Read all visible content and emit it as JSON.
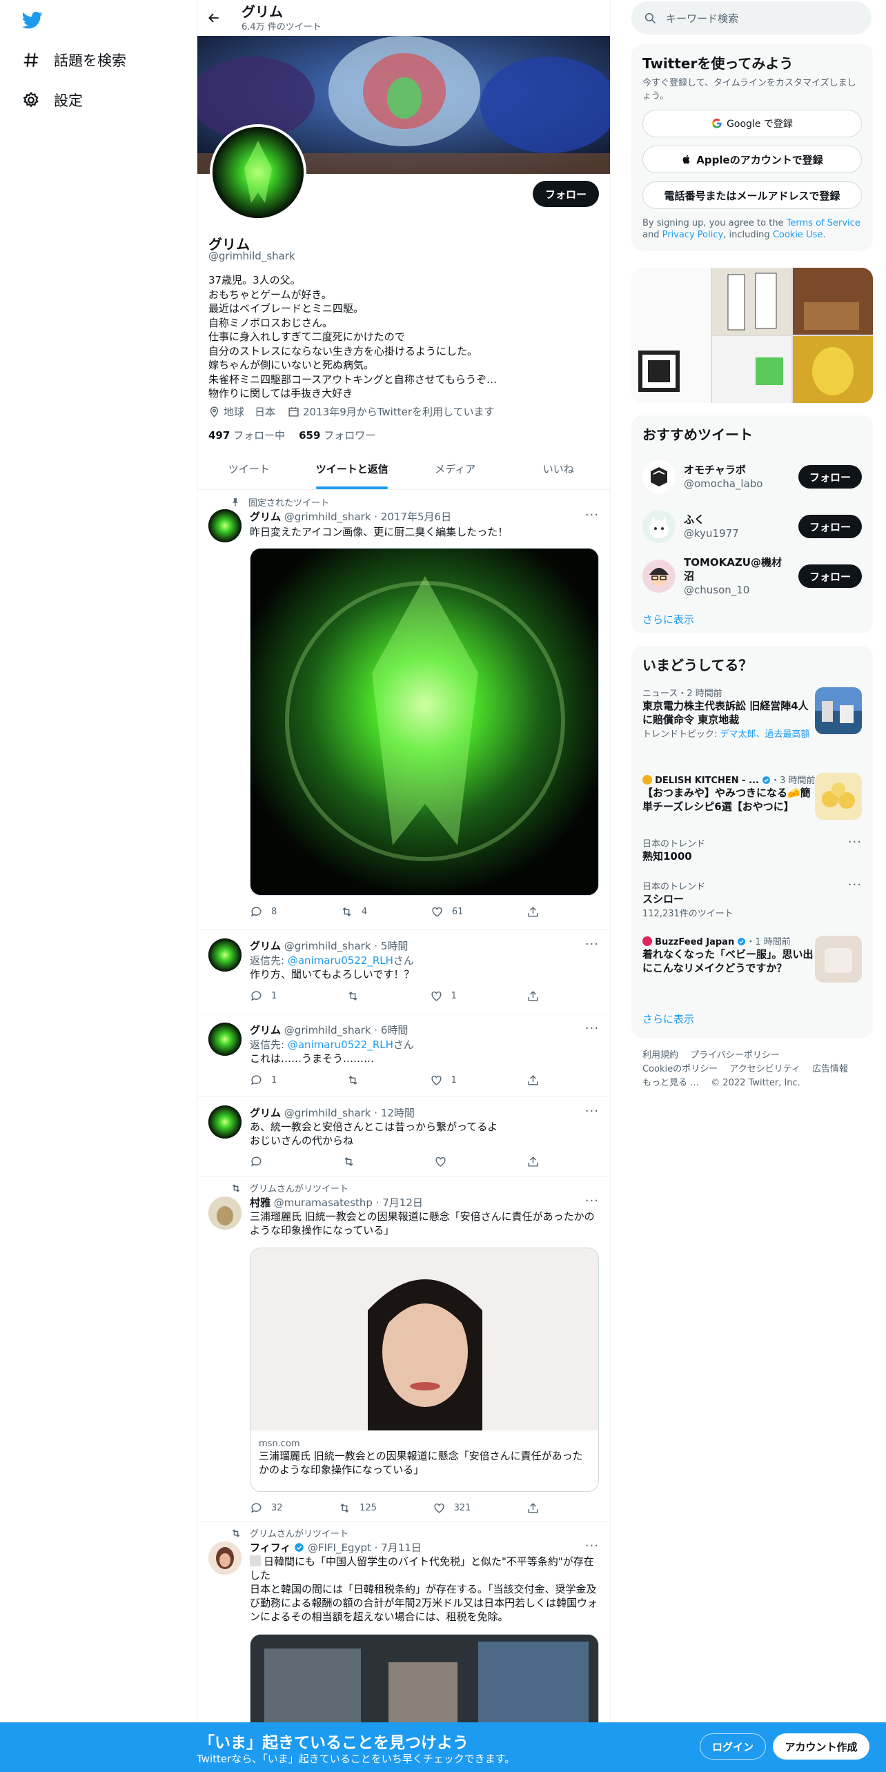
{
  "nav": {
    "explore": "話題を検索",
    "settings": "設定"
  },
  "header": {
    "title": "グリム",
    "subtitle": "6.4万 件のツイート"
  },
  "profile": {
    "name": "グリム",
    "handle": "@grimhild_shark",
    "follow_button": "フォロー",
    "bio": "37歳児。3人の父。\nおもちゃとゲームが好き。\n最近はベイブレードとミニ四駆。\n自称ミノボロスおじさん。\n仕事に身入れしすぎて二度死にかけたので\n自分のストレスにならない生き方を心掛けるようにした。\n嫁ちゃんが側にいないと死ぬ病気。\n朱雀杯ミニ四駆部コースアウトキングと自称させてもらうぞ…\n物作りに関しては手抜き大好き",
    "location": "地球　日本",
    "joined": "2013年9月からTwitterを利用しています",
    "following_count": "497",
    "following_label": "フォロー中",
    "followers_count": "659",
    "followers_label": "フォロワー"
  },
  "tabs": [
    "ツイート",
    "ツイートと返信",
    "メディア",
    "いいね"
  ],
  "tweets": [
    {
      "context": "固定されたツイート",
      "name": "グリム",
      "handle": "@grimhild_shark",
      "time": "2017年5月6日",
      "text": "昨日変えたアイコン画像、更に厨二臭く編集したった！",
      "replies": "8",
      "retweets": "4",
      "likes": "61"
    },
    {
      "name": "グリム",
      "handle": "@grimhild_shark",
      "time": "5時間",
      "reply_prefix": "返信先: ",
      "reply_to": "@animaru0522_RLH",
      "reply_suffix": "さん",
      "text": "作り方、聞いてもよろしいです！？",
      "replies": "1",
      "retweets": "",
      "likes": "1"
    },
    {
      "name": "グリム",
      "handle": "@grimhild_shark",
      "time": "6時間",
      "reply_prefix": "返信先: ",
      "reply_to": "@animaru0522_RLH",
      "reply_suffix": "さん",
      "text": "これは……うまそう………",
      "replies": "1",
      "retweets": "",
      "likes": "1"
    },
    {
      "name": "グリム",
      "handle": "@grimhild_shark",
      "time": "12時間",
      "text": "あ、統一教会と安倍さんとこは昔っから繋がってるよ\nおじいさんの代からね",
      "replies": "",
      "retweets": "",
      "likes": ""
    },
    {
      "context": "グリムさんがリツイート",
      "name": "村雅",
      "handle": "@muramasatesthp",
      "time": "7月12日",
      "text": "三浦瑠麗氏 旧統一教会との因果報道に懸念「安倍さんに責任があったかのような印象操作になっている」",
      "card_domain": "msn.com",
      "card_title": "三浦瑠麗氏 旧統一教会との因果報道に懸念「安倍さんに責任があったかのような印象操作になっている」",
      "replies": "32",
      "retweets": "125",
      "likes": "321"
    },
    {
      "context": "グリムさんがリツイート",
      "name": "フィフィ",
      "handle": "@FIFI_Egypt",
      "time": "7月11日",
      "text": "日韓間にも「中国人留学生のバイト代免税」と似た\"不平等条約\"が存在した\n日本と韓国の間には「日韓租税条約」が存在する。「当該交付金、奨学金及び勤務による報酬の額の合計が年間2万米ドル又は日本円若しくは韓国ウォンによるその相当額を超えない場合には、租税を免除。"
    }
  ],
  "right": {
    "search_placeholder": "キーワード検索",
    "signup": {
      "title": "Twitterを使ってみよう",
      "subtitle": "今すぐ登録して、タイムラインをカスタマイズしましょう。",
      "google": "Google で登録",
      "apple": "Appleのアカウントで登録",
      "phone": "電話番号またはメールアドレスで登録",
      "terms_1": "By signing up, you agree to the ",
      "terms_link1": "Terms of Service",
      "terms_2": " and ",
      "terms_link2": "Privacy Policy",
      "terms_3": ", including ",
      "terms_link3": "Cookie Use",
      "terms_4": "."
    },
    "recommend": {
      "title": "おすすめツイート",
      "users": [
        {
          "name": "オモチャラボ",
          "handle": "@omocha_labo",
          "button": "フォロー"
        },
        {
          "name": "ふく",
          "handle": "@kyu1977",
          "button": "フォロー"
        },
        {
          "name": "TOMOKAZU@機材沼",
          "handle": "@chuson_10",
          "button": "フォロー"
        }
      ],
      "more": "さらに表示"
    },
    "trends": {
      "title": "いまどうしてる？",
      "items": [
        {
          "cat": "ニュース・2 時間前",
          "title": "東京電力株主代表訴訟 旧経営陣4人に賠償命令 東京地裁",
          "sub_label": "トレンドトピック: ",
          "sub": "デマ太郎、過去最高額"
        },
        {
          "cat": "DELISH KITCHEN - ...",
          "cat2": "・3 時間前",
          "title": "【おつまみや】やみつきになる🧀簡単チーズレシピ6選【おやつに】"
        },
        {
          "cat": "日本のトレンド",
          "title": "熟知1000"
        },
        {
          "cat": "日本のトレンド",
          "title": "スシロー",
          "sub": "112,231件のツイート"
        },
        {
          "cat": "BuzzFeed Japan",
          "cat2": "・1 時間前",
          "title": "着れなくなった「ベビー服」。思い出にこんなリメイクどうですか？"
        }
      ],
      "more": "さらに表示"
    },
    "footer": [
      "利用規約",
      "プライバシーポリシー",
      "Cookieのポリシー",
      "アクセシビリティ",
      "広告情報",
      "もっと見る …",
      "© 2022 Twitter, Inc."
    ]
  },
  "bottom": {
    "headline": "「いま」起きていることを見つけよう",
    "sub": "Twitterなら、「いま」起きていることをいち早くチェックできます。",
    "login": "ログイン",
    "signup": "アカウント作成"
  },
  "colors": {
    "accent": "#1d9bf0",
    "dark": "#0f1419",
    "muted": "#536471"
  }
}
